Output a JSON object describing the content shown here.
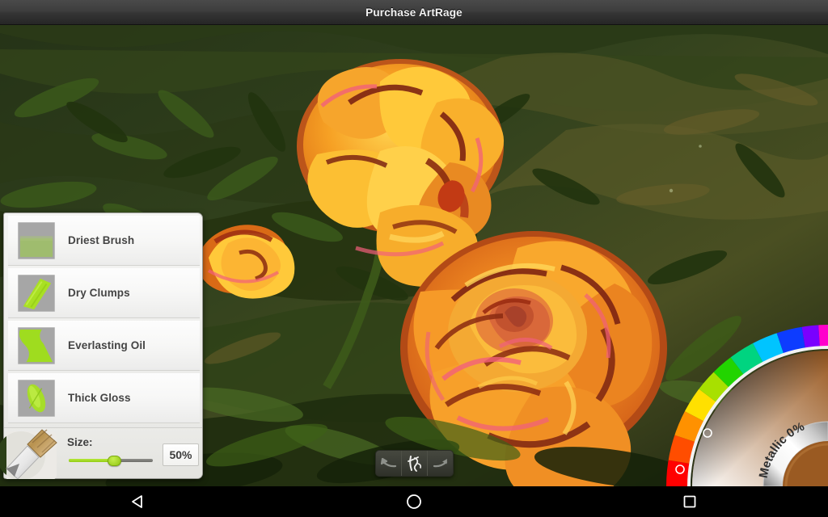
{
  "window": {
    "title": "Purchase ArtRage"
  },
  "canvas": {
    "artwork_description": "Oil painting of orange roses on dark green foliage",
    "colors": {
      "foliage_dark": "#1d2b14",
      "foliage_mid": "#2f4a1e",
      "foliage_light": "#4f6b2a",
      "foliage_olive": "#5a5a2c",
      "rose_orange": "#f59323",
      "rose_yellow": "#ffc93a",
      "rose_pink": "#f2607a",
      "rose_darkred": "#7d2412",
      "rose_deep_orange": "#e2641d"
    }
  },
  "brush_panel": {
    "presets": [
      {
        "label": "Driest Brush",
        "thumb": "driest-brush-thumb",
        "stroke_color": "#9fbc6e"
      },
      {
        "label": "Dry Clumps",
        "thumb": "dry-clumps-thumb",
        "stroke_color": "#a9e023"
      },
      {
        "label": "Everlasting Oil",
        "thumb": "everlasting-oil-thumb",
        "stroke_color": "#9fdc1f"
      },
      {
        "label": "Thick Gloss",
        "thumb": "thick-gloss-thumb",
        "stroke_color": "#a6dd28"
      }
    ],
    "size": {
      "label": "Size:",
      "value": "50%",
      "percent": 50,
      "fill_color": "#a2d620",
      "thumb_position_percent": 46
    },
    "tool_icon": "paintbrush-icon"
  },
  "toolbar": {
    "buttons": [
      {
        "name": "undo-button",
        "icon": "undo-arrow-icon"
      },
      {
        "name": "stroke-tool-button",
        "icon": "calligraphy-stroke-icon"
      },
      {
        "name": "redo-button",
        "icon": "redo-arrow-icon"
      }
    ]
  },
  "color_picker": {
    "metallic_label": "Metallic 0%",
    "current_color": "#9a5a22",
    "hue_marker_label": "hue-selector-marker",
    "sv_marker_label": "saturation-value-marker",
    "hue_stops": [
      "#ff0000",
      "#ff8c00",
      "#ffe400",
      "#8fe000",
      "#00d41c",
      "#00d8a0",
      "#00c8ff",
      "#1a38ff",
      "#8a00ff",
      "#ff00c8",
      "#ff0000"
    ]
  },
  "navigation_bar": {
    "buttons": [
      {
        "name": "back-button",
        "icon": "back-triangle-icon"
      },
      {
        "name": "home-button",
        "icon": "home-circle-icon"
      },
      {
        "name": "recents-button",
        "icon": "recents-square-icon"
      }
    ]
  }
}
